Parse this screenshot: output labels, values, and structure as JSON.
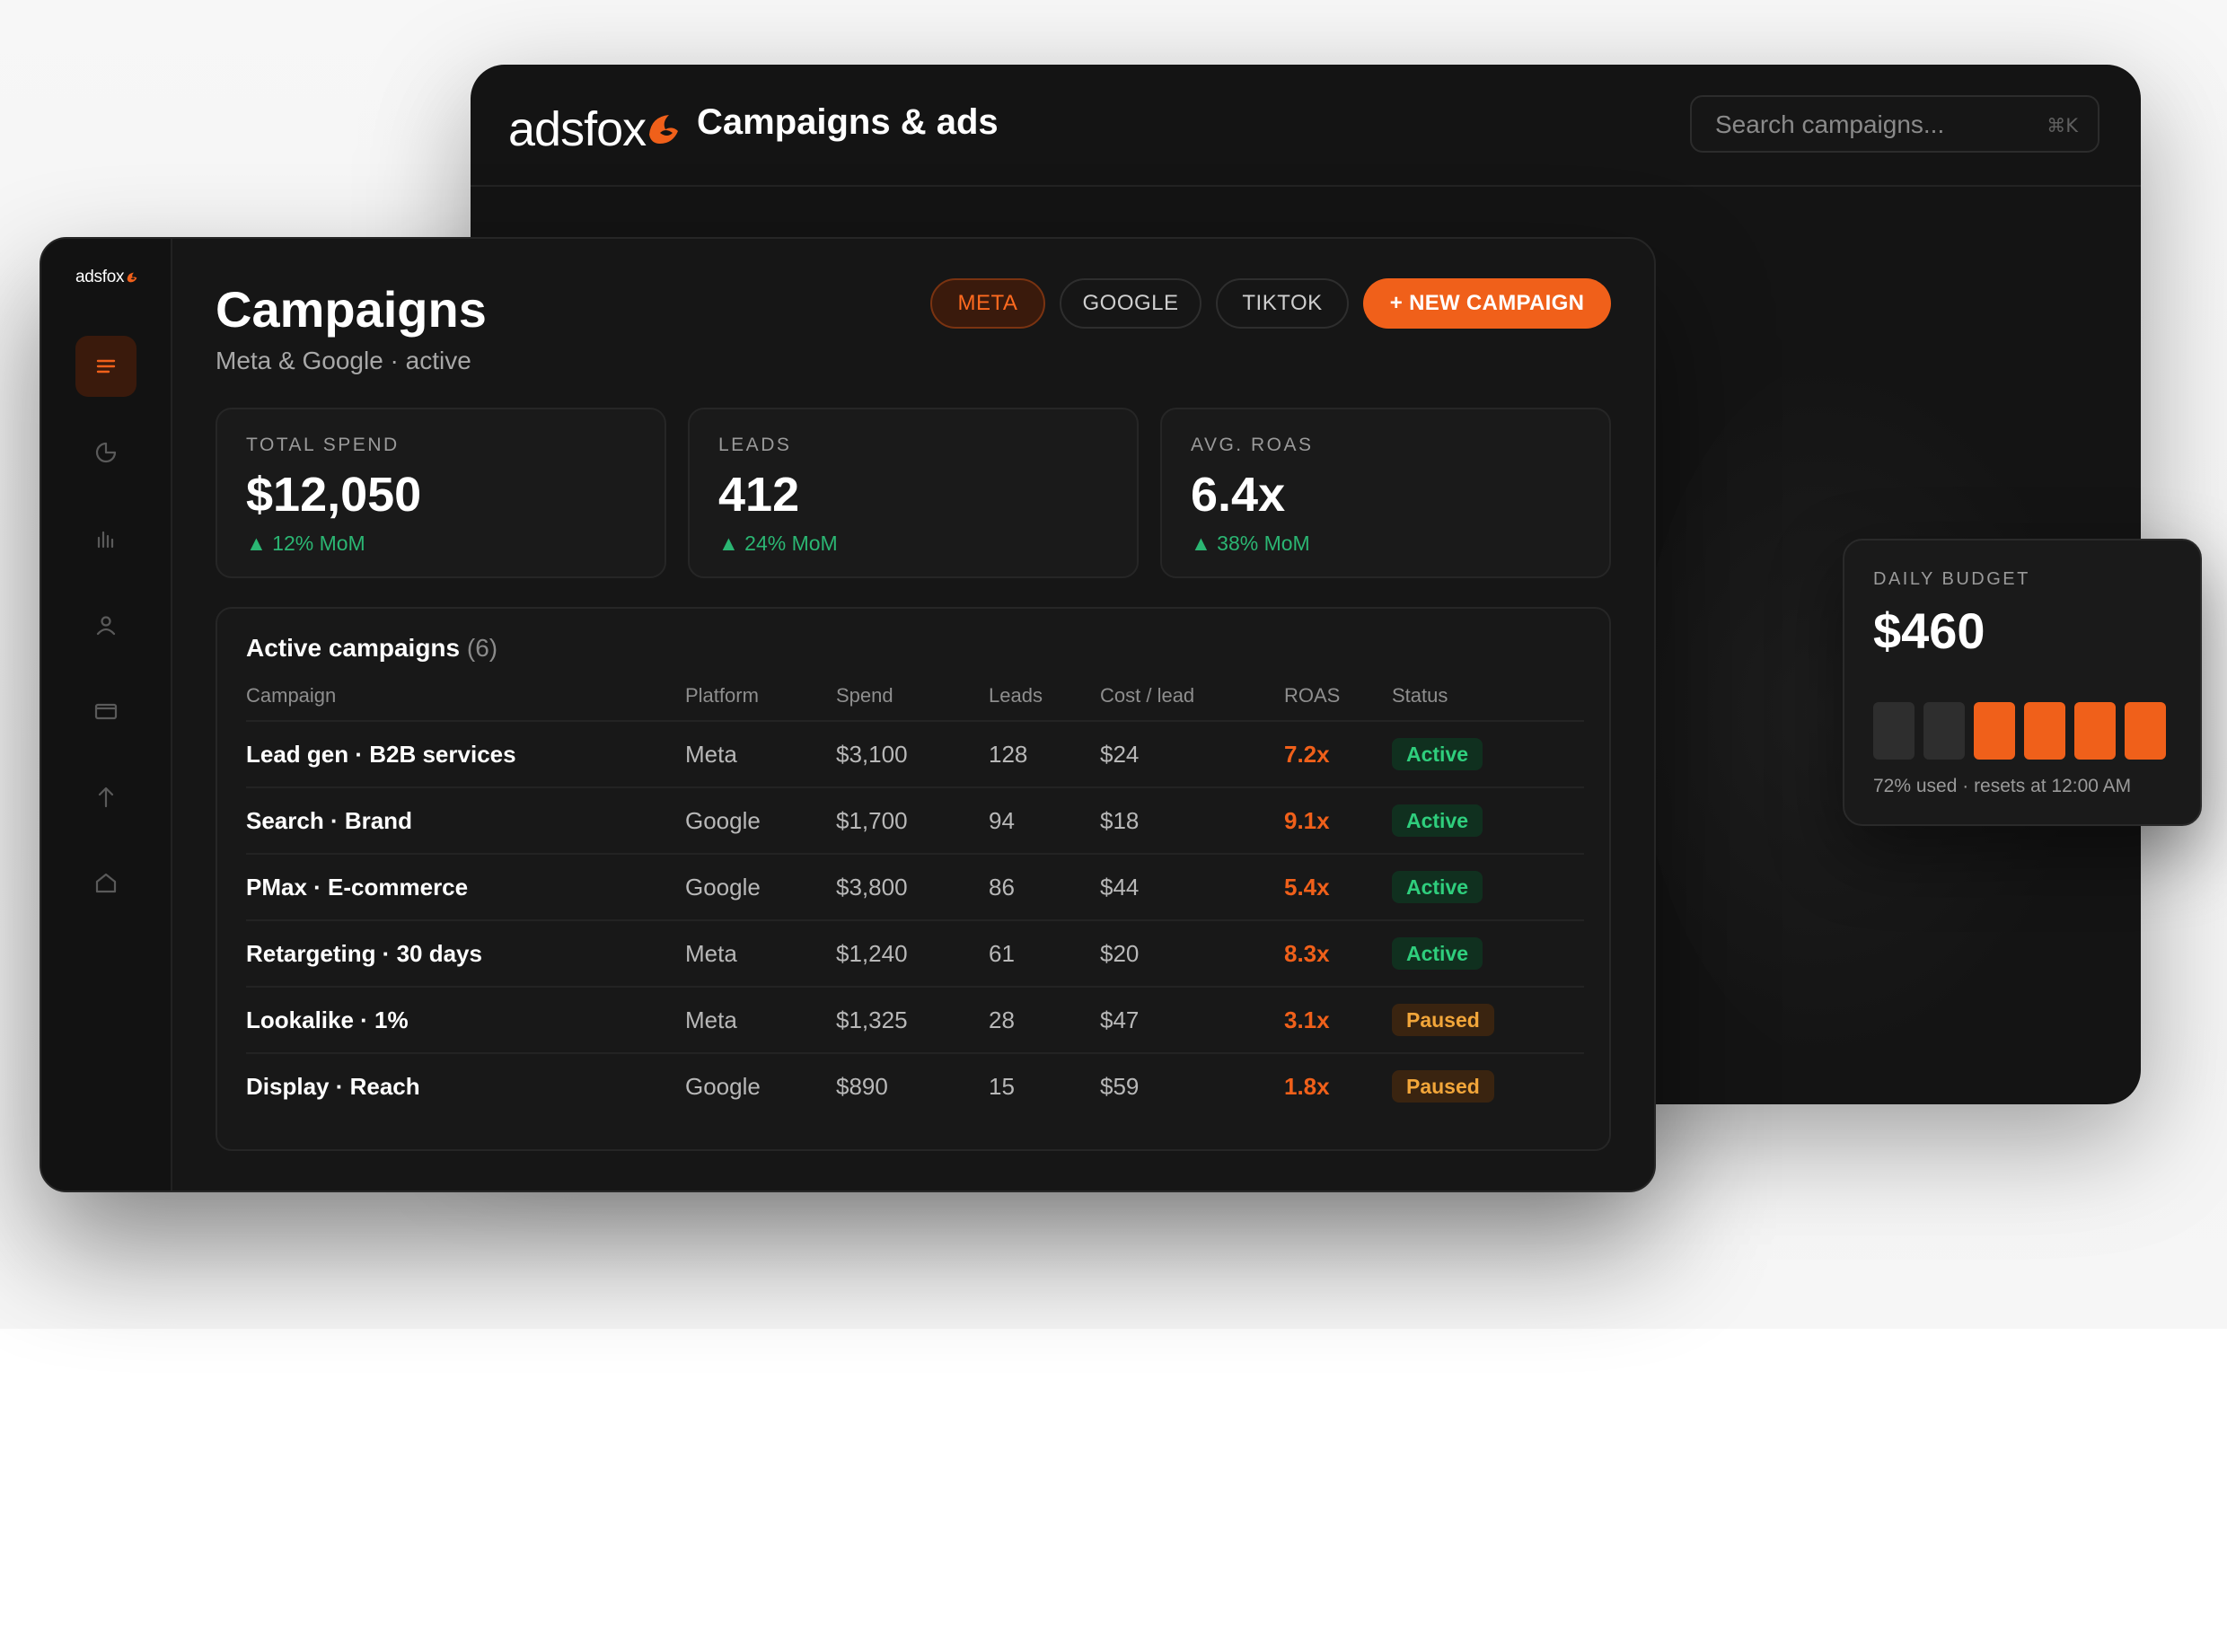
{
  "app": {
    "logo_text": "adsfox",
    "window_title": "Campaigns & ads",
    "search_placeholder": "Search campaigns...",
    "search_shortcut": "⌘K"
  },
  "sidebar": {
    "items": [
      {
        "icon": "list-icon",
        "active": true
      },
      {
        "icon": "pie-chart-icon",
        "active": false
      },
      {
        "icon": "bar-chart-icon",
        "active": false
      },
      {
        "icon": "user-icon",
        "active": false
      },
      {
        "icon": "card-icon",
        "active": false
      },
      {
        "icon": "upload-arrow-icon",
        "active": false
      },
      {
        "icon": "home-icon",
        "active": false
      }
    ]
  },
  "header": {
    "title": "Campaigns",
    "subtitle": "Meta & Google · active",
    "filters": {
      "meta": "META",
      "google": "GOOGLE",
      "tiktok": "TIKTOK"
    },
    "active_filter": "META",
    "new_campaign": "+ NEW CAMPAIGN"
  },
  "stats": [
    {
      "label": "TOTAL SPEND",
      "value": "$12,050",
      "delta": "12% MoM"
    },
    {
      "label": "LEADS",
      "value": "412",
      "delta": "24% MoM"
    },
    {
      "label": "AVG. ROAS",
      "value": "6.4x",
      "delta": "38% MoM"
    }
  ],
  "delta_arrow": "▲",
  "table": {
    "title": "Active campaigns",
    "count": "(6)",
    "columns": [
      "Campaign",
      "Platform",
      "Spend",
      "Leads",
      "Cost / lead",
      "ROAS",
      "Status"
    ],
    "rows": [
      [
        "Lead gen · B2B services",
        "Meta",
        "$3,100",
        "128",
        "$24",
        "7.2x",
        "Active"
      ],
      [
        "Search · Brand",
        "Google",
        "$1,700",
        "94",
        "$18",
        "9.1x",
        "Active"
      ],
      [
        "PMax · E-commerce",
        "Google",
        "$3,800",
        "86",
        "$44",
        "5.4x",
        "Active"
      ],
      [
        "Retargeting · 30 days",
        "Meta",
        "$1,240",
        "61",
        "$20",
        "8.3x",
        "Active"
      ],
      [
        "Lookalike · 1%",
        "Meta",
        "$1,325",
        "28",
        "$47",
        "3.1x",
        "Paused"
      ],
      [
        "Display · Reach",
        "Google",
        "$890",
        "15",
        "$59",
        "1.8x",
        "Paused"
      ]
    ]
  },
  "budget": {
    "label": "DAILY BUDGET",
    "value": "$460",
    "used_fraction": 0.72,
    "segments_total": 6,
    "segments_filled": 4,
    "note": "72% used · resets at 12:00 AM"
  },
  "colors": {
    "accent": "#f0601a",
    "positive": "#2bb673",
    "active_badge": "#2fce7d",
    "paused_badge": "#f2a63a",
    "background": "#141414"
  }
}
